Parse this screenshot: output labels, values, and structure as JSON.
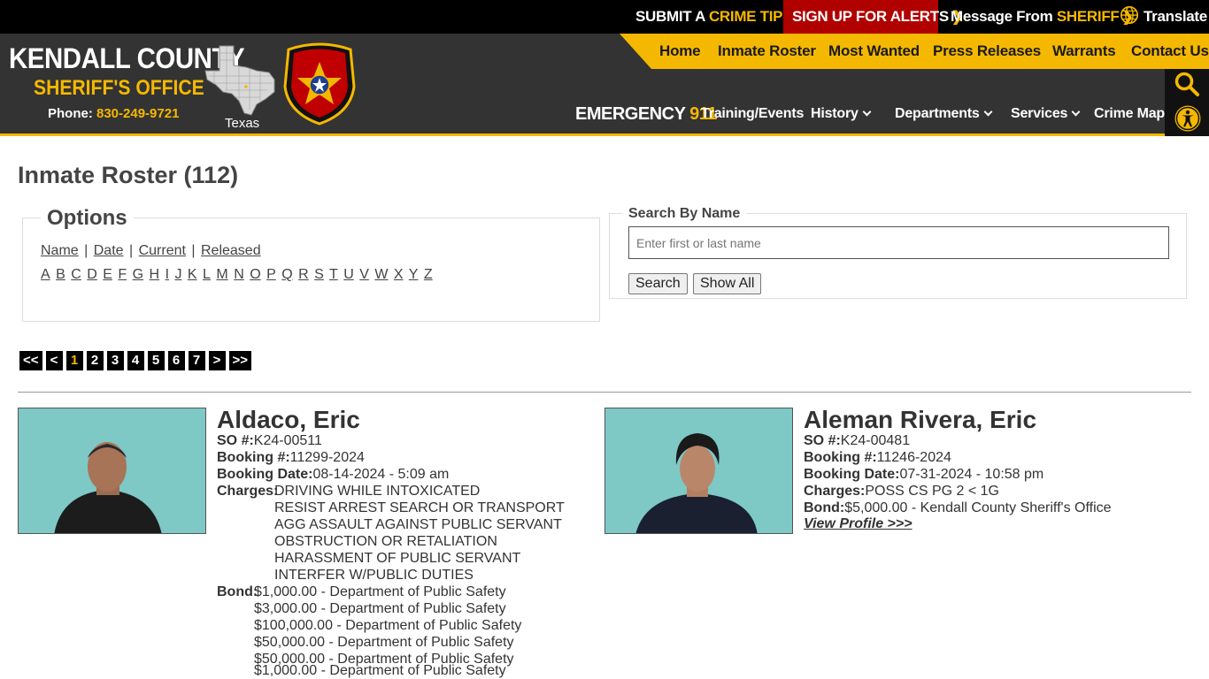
{
  "topbar": {
    "crime_tip": {
      "prefix": "SUBMIT A ",
      "highlight": "CRIME TIP"
    },
    "alerts": "SIGN UP FOR ALERTS",
    "message": {
      "prefix": "Message From ",
      "highlight": "SHERIFF"
    },
    "translate": "Translate"
  },
  "brand": {
    "title": "KENDALL COUNTY",
    "subtitle": "SHERIFF'S OFFICE",
    "phone_label": "Phone: ",
    "phone_number": "830-249-9721",
    "state_label": "Texas"
  },
  "nav": {
    "main": [
      "Home",
      "Inmate Roster",
      "Most Wanted",
      "Press Releases",
      "Warrants",
      "Contact Us"
    ],
    "emergency": {
      "prefix": "EMERGENCY ",
      "number": "911"
    },
    "sub": [
      "Training/Events",
      "History",
      "Departments",
      "Services",
      "Crime Map"
    ]
  },
  "page": {
    "title": "Inmate Roster (112)"
  },
  "options": {
    "legend": "Options",
    "sort_links": [
      "Name",
      "Date",
      "Current",
      "Released"
    ],
    "letters": [
      "A",
      "B",
      "C",
      "D",
      "E",
      "F",
      "G",
      "H",
      "I",
      "J",
      "K",
      "L",
      "M",
      "N",
      "O",
      "P",
      "Q",
      "R",
      "S",
      "T",
      "U",
      "V",
      "W",
      "X",
      "Y",
      "Z"
    ]
  },
  "search": {
    "legend": "Search By Name",
    "placeholder": "Enter first or last name",
    "search_button": "Search",
    "show_all_button": "Show All"
  },
  "pager": {
    "items": [
      "<<",
      "<",
      "1",
      "2",
      "3",
      "4",
      "5",
      "6",
      "7",
      ">",
      ">>"
    ],
    "active": "1"
  },
  "inmates": [
    {
      "name": "Aldaco, Eric",
      "so_label": "SO #:",
      "so": "K24-00511",
      "booking_label": "Booking #:",
      "booking": "11299-2024",
      "date_label": "Booking Date:",
      "date": "08-14-2024 - 5:09 am",
      "charges_label": "Charges:",
      "charges": [
        "DRIVING WHILE INTOXICATED",
        "RESIST ARREST SEARCH OR TRANSPORT",
        "AGG ASSAULT AGAINST PUBLIC SERVANT",
        "OBSTRUCTION OR RETALIATION",
        "HARASSMENT OF PUBLIC SERVANT",
        "INTERFER W/PUBLIC DUTIES"
      ],
      "bond_label": "Bond:",
      "bonds": [
        "$1,000.00 - Department of Public Safety",
        "$3,000.00 - Department of Public Safety",
        "$100,000.00 - Department of Public Safety",
        "$50,000.00 - Department of Public Safety",
        "$50,000.00 - Department of Public Safety",
        "$1,000.00 - Department of Public Safety"
      ]
    },
    {
      "name": "Aleman Rivera, Eric",
      "so_label": "SO #:",
      "so": "K24-00481",
      "booking_label": "Booking #:",
      "booking": "11246-2024",
      "date_label": "Booking Date:",
      "date": "07-31-2024 - 10:58 pm",
      "charges_label": "Charges:",
      "charges": [
        "POSS CS PG 2 < 1G"
      ],
      "bond_label": "Bond:",
      "bonds": [
        "$5,000.00 - Kendall County Sheriff's Office"
      ],
      "profile_link": "View Profile >>>"
    }
  ],
  "colors": {
    "accent": "#f5b800",
    "alert_red": "#b00000",
    "header_bg": "#333333",
    "photo_bg": "#7ec8c6"
  }
}
